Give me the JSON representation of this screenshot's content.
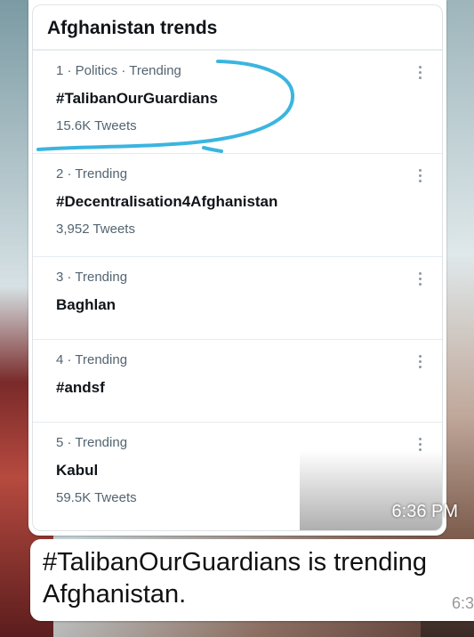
{
  "panel": {
    "title": "Afghanistan trends"
  },
  "trends": [
    {
      "meta": "1 · Politics · Trending",
      "name": "#TalibanOurGuardians",
      "count": "15.6K Tweets"
    },
    {
      "meta": "2 · Trending",
      "name": "#Decentralisation4Afghanistan",
      "count": "3,952 Tweets"
    },
    {
      "meta": "3 · Trending",
      "name": "Baghlan",
      "count": ""
    },
    {
      "meta": "4 · Trending",
      "name": "#andsf",
      "count": ""
    },
    {
      "meta": "5 · Trending",
      "name": "Kabul",
      "count": "59.5K Tweets"
    }
  ],
  "image_timestamp": "6:36 PM",
  "caption": {
    "line1": "#TalibanOurGuardians is trending",
    "line2": "Afghanistan.",
    "time": "6:3"
  },
  "colors": {
    "scribble": "#3bb5e0",
    "link_text": "#0f1419",
    "meta_text": "#536471"
  }
}
